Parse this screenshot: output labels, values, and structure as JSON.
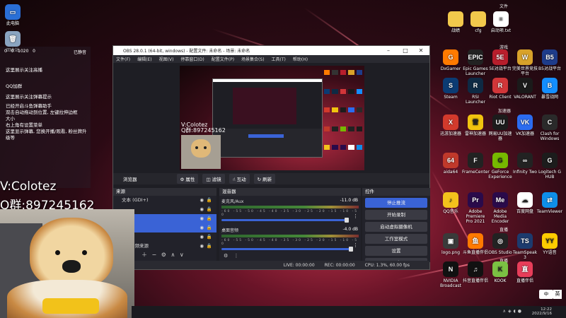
{
  "desktop_left": [
    {
      "label": "此电脑",
      "icon": "computer-icon",
      "color": "#4aa3ff",
      "glyph": "▭"
    },
    {
      "label": "回收站",
      "icon": "recycle-bin-icon",
      "color": "#ffffff",
      "glyph": "🗑"
    }
  ],
  "chat": {
    "time": "已静音",
    "stats": [
      "0",
      "0",
      "1020",
      "0"
    ],
    "lines": [
      "这里展示关注高播",
      "QQ加群",
      "这里展示关注弹幕提示",
      "已经开启斗鱼弹幕助手",
      "双击自动拖动到位置, 左键拉伸边框",
      "大小",
      "右上角有设置菜单",
      "这里显示弹幕, 您换开播/观看, 粉丝牌升级等"
    ]
  },
  "desktop_right_top": [
    {
      "label": "战绩",
      "icon": "folder-icon"
    },
    {
      "label": "cfg",
      "icon": "folder-icon"
    },
    {
      "label": "启动项.txt",
      "icon": "text-file-icon"
    }
  ],
  "section_labels": {
    "s1": "文件",
    "s2": "游戏",
    "s3": "加速器",
    "s4": "直播",
    "s5": "直播"
  },
  "desktop_grid": [
    {
      "label": "DxGamer",
      "icon": "dxgamer-icon",
      "color": "#ff7a00",
      "glyph": "G"
    },
    {
      "label": "Epic Games Launcher",
      "icon": "epic-games-icon",
      "color": "#222222",
      "glyph": "EPIC"
    },
    {
      "label": "5E对战平台",
      "icon": "5e-icon",
      "color": "#b81e2c",
      "glyph": "5E"
    },
    {
      "label": "完美世界竞技平台",
      "icon": "perfect-world-icon",
      "color": "#d8a22a",
      "glyph": "W"
    },
    {
      "label": "B5对战平台",
      "icon": "b5-icon",
      "color": "#1e3c8a",
      "glyph": "B5"
    },
    {
      "label": "Steam",
      "icon": "steam-icon",
      "color": "#0b3b73",
      "glyph": "S"
    },
    {
      "label": "RSI Launcher",
      "icon": "rsi-icon",
      "color": "#0e2a44",
      "glyph": "R"
    },
    {
      "label": "Riot Client",
      "icon": "riot-icon",
      "color": "#d13639",
      "glyph": "R"
    },
    {
      "label": "VALORANT",
      "icon": "valorant-icon",
      "color": "#1a1a1a",
      "glyph": "V"
    },
    {
      "label": "暴雪战网",
      "icon": "battlenet-icon",
      "color": "#148eff",
      "glyph": "B"
    },
    {
      "label": "迅游加速器",
      "icon": "xunyou-icon",
      "color": "#d33a2c",
      "glyph": "X"
    },
    {
      "label": "雷神加速器",
      "icon": "leishen-icon",
      "color": "#f1c40f",
      "glyph": "雷"
    },
    {
      "label": "网易UU加速器",
      "icon": "uu-icon",
      "color": "#1c1c1c",
      "glyph": "UU"
    },
    {
      "label": "VK加速器",
      "icon": "vk-icon",
      "color": "#2b6cf0",
      "glyph": "VK"
    },
    {
      "label": "Clash for Windows",
      "icon": "clash-icon",
      "color": "#2a2a2a",
      "glyph": "C"
    },
    {
      "label": "aida64",
      "icon": "aida64-icon",
      "color": "#c0392b",
      "glyph": "64"
    },
    {
      "label": "FrameCenter",
      "icon": "framecenter-icon",
      "color": "#222222",
      "glyph": "F"
    },
    {
      "label": "GeForce Experience",
      "icon": "geforce-icon",
      "color": "#76b900",
      "glyph": "G"
    },
    {
      "label": "Infinity Two",
      "icon": "infinity-icon",
      "color": "#222222",
      "glyph": "∞"
    },
    {
      "label": "Logitech G HUB",
      "icon": "logitech-icon",
      "color": "#1c1c1c",
      "glyph": "G"
    },
    {
      "label": "QQ音乐",
      "icon": "qq-music-icon",
      "color": "#f4c21c",
      "glyph": "♪"
    },
    {
      "label": "Adobe Premiere Pro 2021",
      "icon": "premiere-icon",
      "color": "#2a0a4a",
      "glyph": "Pr"
    },
    {
      "label": "Adobe Media Encoder",
      "icon": "media-encoder-icon",
      "color": "#2a0a4a",
      "glyph": "Me"
    },
    {
      "label": "百度网盘",
      "icon": "baidu-netdisk-icon",
      "color": "#ffffff",
      "glyph": "☁"
    },
    {
      "label": "TeamViewer",
      "icon": "teamviewer-icon",
      "color": "#0e8ee9",
      "glyph": "⇄"
    },
    {
      "label": "logo.png",
      "icon": "image-file-icon",
      "color": "#3a3a3a",
      "glyph": "▣"
    },
    {
      "label": "斗鱼直播伴侣",
      "icon": "douyu-icon",
      "color": "#ff7a00",
      "glyph": "鱼"
    },
    {
      "label": "OBS Studio",
      "icon": "obs-icon",
      "color": "#222222",
      "glyph": "◎"
    },
    {
      "label": "TeamSpeak 3",
      "icon": "teamspeak-icon",
      "color": "#1c3b6e",
      "glyph": "TS"
    },
    {
      "label": "YY语音",
      "icon": "yy-icon",
      "color": "#ffcc00",
      "glyph": "YY"
    },
    {
      "label": "NVIDIA Broadcast",
      "icon": "nvidia-broadcast-icon",
      "color": "#111111",
      "glyph": "N"
    },
    {
      "label": "抖音直播伴侣",
      "icon": "douyin-icon",
      "color": "#111111",
      "glyph": "♫"
    },
    {
      "label": "KOOK",
      "icon": "kook-icon",
      "color": "#7bc143",
      "glyph": "K"
    },
    {
      "label": "直播伴侣",
      "icon": "live-companion-icon",
      "color": "#e83e5a",
      "glyph": "直"
    }
  ],
  "obs": {
    "title": "OBS 28.0.1 (64-bit, windows) - 配置文件: 未命名 - 场景: 未命名",
    "menu": [
      "文件(F)",
      "编辑(E)",
      "视图(V)",
      "停靠窗口(D)",
      "配置文件(P)",
      "场景集合(S)",
      "工具(T)",
      "帮助(H)"
    ],
    "toolbar": [
      "浏览器",
      "属性",
      "滤镜",
      "互动",
      "刷新"
    ],
    "scenes_header": "来源",
    "sources": [
      "文本 (GDI+)",
      "",
      "",
      "",
      "",
      "音频来源"
    ],
    "mixer_header": "混音器",
    "mixer": [
      {
        "name": "麦克风/Aux",
        "db": "-11.0 dB"
      },
      {
        "name": "桌面音频",
        "db": "-4.0 dB"
      }
    ],
    "scale": "-60 -55 -50 -45 -40 -35 -30 -25 -20 -15 -10 -5 0",
    "controls_header": "控件",
    "controls": [
      "停止推流",
      "开始录制",
      "启动虚拟摄像机",
      "工作室模式",
      "设置",
      "退出"
    ],
    "status": {
      "live": "LIVE: 00:00:00",
      "rec": "REC: 00:00:00",
      "cpu": "CPU: 1.3%, 60.00 fps"
    }
  },
  "overlay": {
    "line1": "V:Colotez",
    "line2": "Q群:897245162"
  },
  "ime": {
    "mode": "中",
    "alt": "英"
  },
  "tray": {
    "time": "12:22",
    "date": "2022/9/16"
  },
  "colors": {
    "accent": "#3a63d6",
    "obs_bg": "#1e1e24"
  }
}
